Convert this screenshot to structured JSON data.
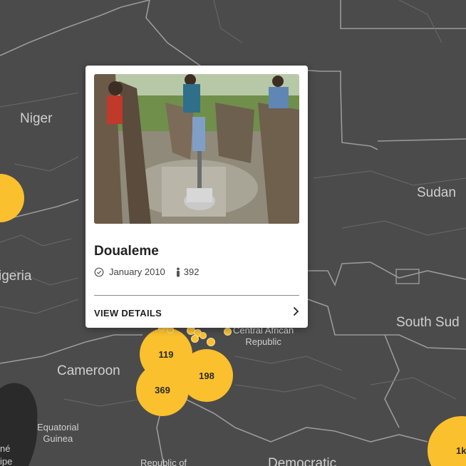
{
  "map": {
    "country_labels": {
      "niger": "Niger",
      "nigeria": "igeria",
      "cameroon": "Cameroon",
      "sudan": "Sudan",
      "south_sudan": "South Sud",
      "car_line1": "Central African",
      "car_line2": "Republic",
      "eq_guinea_line1": "Equatorial",
      "eq_guinea_line2": "Guinea",
      "republic_of": "Republic of",
      "democratic": "Democratic",
      "left_edge_1": "né",
      "left_edge_2": "ipe"
    },
    "clusters": {
      "c119": "119",
      "c198": "198",
      "c369": "369",
      "c1k": "1k"
    }
  },
  "popup": {
    "title": "Doualeme",
    "date": "January 2010",
    "people_count": "392",
    "date_icon": "check-circle-icon",
    "people_icon": "person-icon",
    "action_label": "VIEW DETAILS",
    "action_icon": "chevron-right-icon",
    "image_alt": "Hand water pump surrounded by villagers"
  },
  "colors": {
    "map_bg": "#4b4b4b",
    "borders": "#8c8c8c",
    "cluster": "#fbc02d",
    "water": "#262626"
  }
}
